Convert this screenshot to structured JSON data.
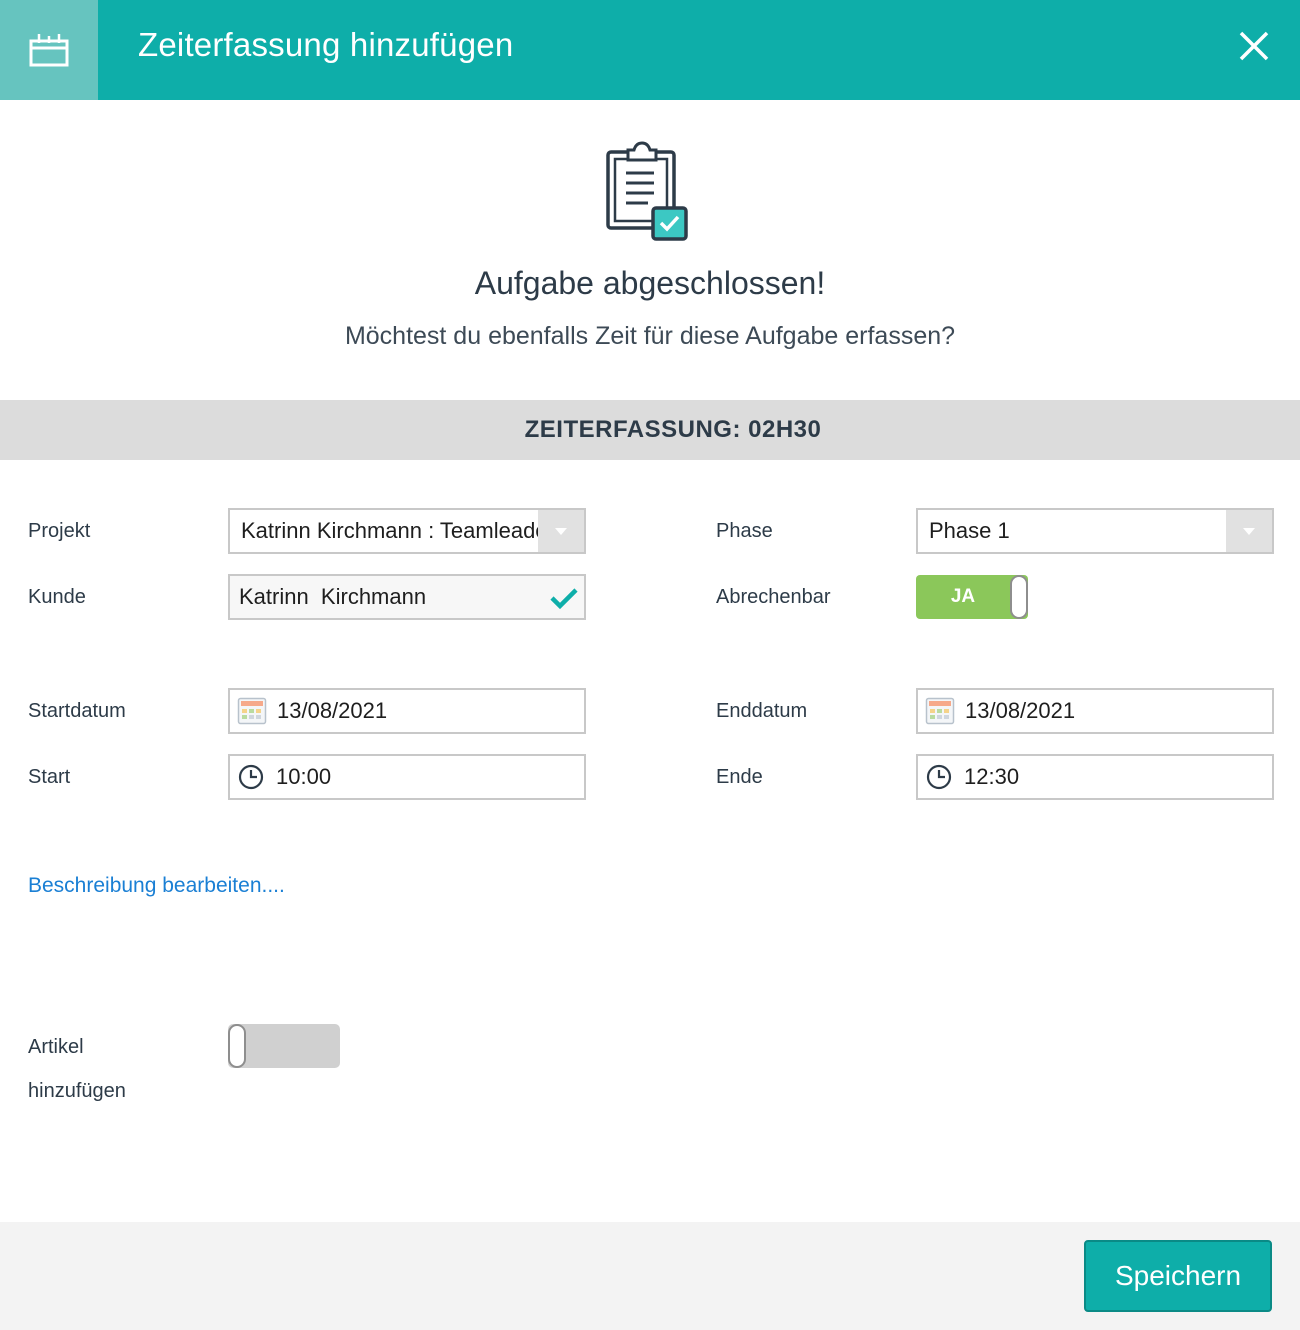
{
  "header": {
    "title": "Zeiterfassung hinzufügen",
    "icon": "calendar-icon",
    "close_icon": "close-icon"
  },
  "hero": {
    "icon": "clipboard-check-icon",
    "title": "Aufgabe abgeschlossen!",
    "subtitle": "Möchtest du ebenfalls Zeit für diese Aufgabe erfassen?"
  },
  "section": {
    "title": "ZEITERFASSUNG: 02H30"
  },
  "form": {
    "projekt": {
      "label": "Projekt",
      "value": "Katrinn Kirchmann : Teamleader"
    },
    "kunde": {
      "label": "Kunde",
      "value": "Katrinn  Kirchmann"
    },
    "phase": {
      "label": "Phase",
      "value": "Phase 1"
    },
    "abrechenbar": {
      "label": "Abrechenbar",
      "value": "JA",
      "on": true
    },
    "startdatum": {
      "label": "Startdatum",
      "value": "13/08/2021"
    },
    "enddatum": {
      "label": "Enddatum",
      "value": "13/08/2021"
    },
    "start": {
      "label": "Start",
      "value": "10:00"
    },
    "ende": {
      "label": "Ende",
      "value": "12:30"
    },
    "description_link": "Beschreibung bearbeiten....",
    "artikel": {
      "label_line1": "Artikel",
      "label_line2": "hinzufügen",
      "on": false
    }
  },
  "footer": {
    "save_label": "Speichern"
  },
  "colors": {
    "accent": "#0eaea9",
    "toggle_on": "#8bc75a",
    "link": "#1a7fd4"
  }
}
